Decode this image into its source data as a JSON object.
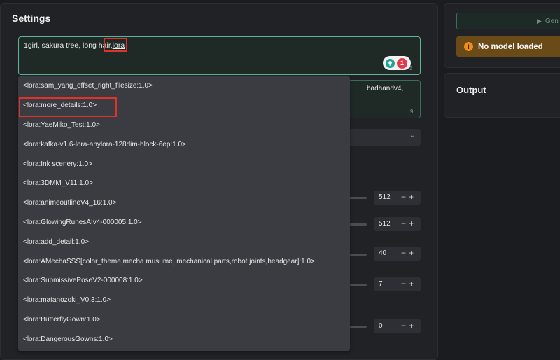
{
  "settings": {
    "title": "Settings",
    "prompt_prefix": "1girl, sakura tree, long hair,",
    "prompt_current_word": "lora",
    "prompt_char_count": "5",
    "issue_count": "1",
    "negative_tail": "badhandv4,",
    "negative_char_count": "9",
    "select_value": ""
  },
  "sliders": [
    {
      "value": "512"
    },
    {
      "value": "512"
    },
    {
      "value": "40"
    },
    {
      "value": "7"
    },
    {
      "value": "0"
    }
  ],
  "stepper": {
    "minus": "−",
    "plus": "+"
  },
  "autocomplete": {
    "items": [
      "<lora:sam_yang_offset_right_filesize:1.0>",
      "<lora:more_details:1.0>",
      "<lora:YaeMiko_Test:1.0>",
      "<lora:kafka-v1.6-lora-anylora-128dim-block-6ep:1.0>",
      "<lora:Ink scenery:1.0>",
      "<lora:3DMM_V11:1.0>",
      "<lora:animeoutlineV4_16:1.0>",
      "<lora:GlowingRunesAIv4-000005:1.0>",
      "<lora:add_detail:1.0>",
      "<lora:AMechaSSS[color_theme,mecha musume, mechanical parts,robot joints,headgear]:1.0>",
      "<lora:SubmissivePoseV2-000008:1.0>",
      "<lora:matanozoki_V0.3:1.0>",
      "<lora:ButterflyGown:1.0>",
      "<lora:DangerousGowns:1.0>"
    ]
  },
  "generate": {
    "label": "Gen"
  },
  "warning": {
    "text": "No model loaded",
    "icon": "!"
  },
  "output": {
    "title": "Output"
  },
  "icons": {
    "bulb": "lightbulb-icon",
    "play": "play-icon",
    "chevron": "chevron-down-icon",
    "warning": "warning-icon"
  },
  "colors": {
    "accent": "#5fb39a",
    "highlight": "#e0322a",
    "warning_bg": "#6a4a17",
    "warning_icon": "#f08c1a"
  }
}
